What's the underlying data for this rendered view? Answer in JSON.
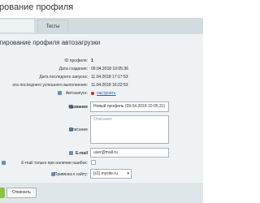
{
  "header": {
    "title": "рование профиля"
  },
  "tabs": [
    {
      "label": ""
    },
    {
      "label": "Тесты"
    }
  ],
  "section_title": "тирование профиля автозагрузки",
  "fields": {
    "id": {
      "label": "ID профиля:",
      "value": "1"
    },
    "created": {
      "label": "Дата создания:",
      "value": "09.04.2018 10:05:36"
    },
    "last_run": {
      "label": "Дата последнего запуска:",
      "value": "11.04.2018 17:17:53"
    },
    "last_success": {
      "label": "ата последнего успешного выполнения:",
      "value": "11.04.2018 16:22:53"
    },
    "autostart": {
      "label": "Автозапуск:",
      "link": "настроить",
      "status_color": "#d9261c"
    },
    "name": {
      "label": "Название",
      "value": "Новый профиль (09.04.2018 10:05:31)"
    },
    "description": {
      "label": "Описание",
      "placeholder": "Описание"
    },
    "email": {
      "label": "E-mail",
      "value": "user@mail.ru"
    },
    "email_errors_only": {
      "label": "E-mail только при наличии ошибок:"
    },
    "site": {
      "label": "Привязка к сайту:",
      "value": "[s1] mysite.ru"
    }
  },
  "footer": {
    "cancel_label": "Отменить"
  },
  "colors": {
    "accent_green": "#8bc34a",
    "link": "#2067b0",
    "panel_bg": "#eef2f4",
    "tabs_bg": "#d2dbe0"
  }
}
